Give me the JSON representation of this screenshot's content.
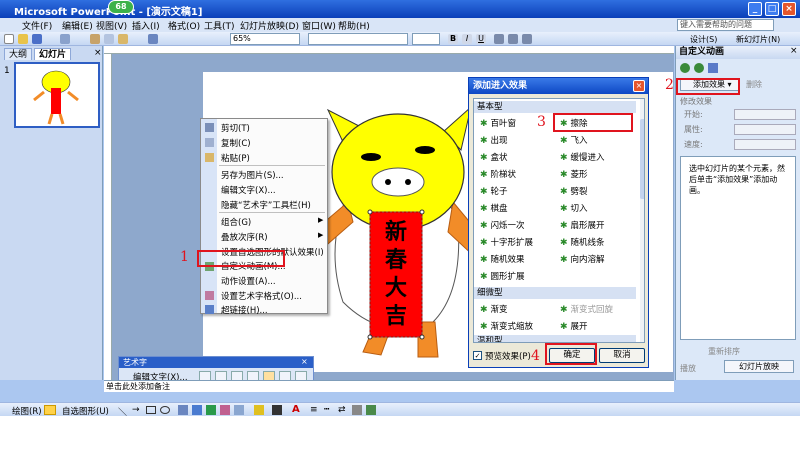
{
  "titlebar": {
    "title": "Microsoft PowerPoint - [演示文稿1]",
    "badge": "68"
  },
  "menubar": {
    "items": [
      "文件(F)",
      "编辑(E)",
      "视图(V)",
      "插入(I)",
      "格式(O)",
      "工具(T)",
      "幻灯片放映(D)",
      "窗口(W)",
      "帮助(H)"
    ],
    "help_placeholder": "键入需要帮助的问题"
  },
  "toolbar_std": {
    "zoom": "65%",
    "design_label": "设计(S)",
    "new_slide_label": "新幻灯片(N)"
  },
  "leftpanel": {
    "tab_outline": "大纲",
    "tab_slides": "幻灯片",
    "slide_number": "1"
  },
  "slide": {
    "text": [
      "新",
      "春",
      "大",
      "吉"
    ]
  },
  "notes": {
    "placeholder": "单击此处添加备注"
  },
  "context_menu": {
    "items": [
      "剪切(T)",
      "复制(C)",
      "粘贴(P)",
      "另存为图片(S)...",
      "编辑文字(X)...",
      "隐藏“艺术字”工具栏(H)",
      "组合(G)",
      "叠放次序(R)",
      "设置自选图形的默认效果(I)",
      "自定义动画(M)...",
      "动作设置(A)...",
      "设置艺术字格式(O)...",
      "超链接(H)..."
    ]
  },
  "wordart_toolbar": {
    "title": "艺术字",
    "edit_label": "编辑文字(X)..."
  },
  "dialog": {
    "title": "添加进入效果",
    "category_basic": "基本型",
    "basic_effects_left": [
      "百叶窗",
      "出现",
      "盒状",
      "阶梯状",
      "轮子",
      "棋盘",
      "闪烁一次",
      "十字形扩展",
      "随机效果",
      "圆形扩展"
    ],
    "basic_effects_right": [
      "擦除",
      "飞入",
      "缓慢进入",
      "菱形",
      "劈裂",
      "切入",
      "扇形展开",
      "随机线条",
      "向内溶解"
    ],
    "category_subtle": "细微型",
    "subtle_effects_left": [
      "渐变",
      "渐变式缩放"
    ],
    "subtle_effects_right": [
      "渐变式回旋",
      "展开"
    ],
    "category_moderate": "温和型",
    "preview_label": "预览效果(P)",
    "ok_label": "确定",
    "cancel_label": "取消"
  },
  "taskpane": {
    "title": "自定义动画",
    "add_effect_label": "添加效果",
    "remove_label": "删除",
    "modify_label": "修改效果",
    "start_label": "开始:",
    "property_label": "属性:",
    "speed_label": "速度:",
    "hint": "选中幻灯片的某个元素，然后单击“添加效果”添加动画。",
    "reorder_label": "重新排序",
    "play_label": "播放",
    "slideshow_label": "幻灯片放映"
  },
  "drawing_toolbar": {
    "draw_label": "绘图(R)",
    "autoshape_label": "自选图形(U)"
  },
  "annotations": {
    "n1": "1",
    "n2": "2",
    "n3": "3",
    "n4": "4"
  },
  "colors": {
    "accent": "#0a3fb8",
    "highlight": "#e0141e",
    "pig_face": "#ffff00",
    "pig_limbs": "#f28c28",
    "banner": "#ff0000"
  }
}
